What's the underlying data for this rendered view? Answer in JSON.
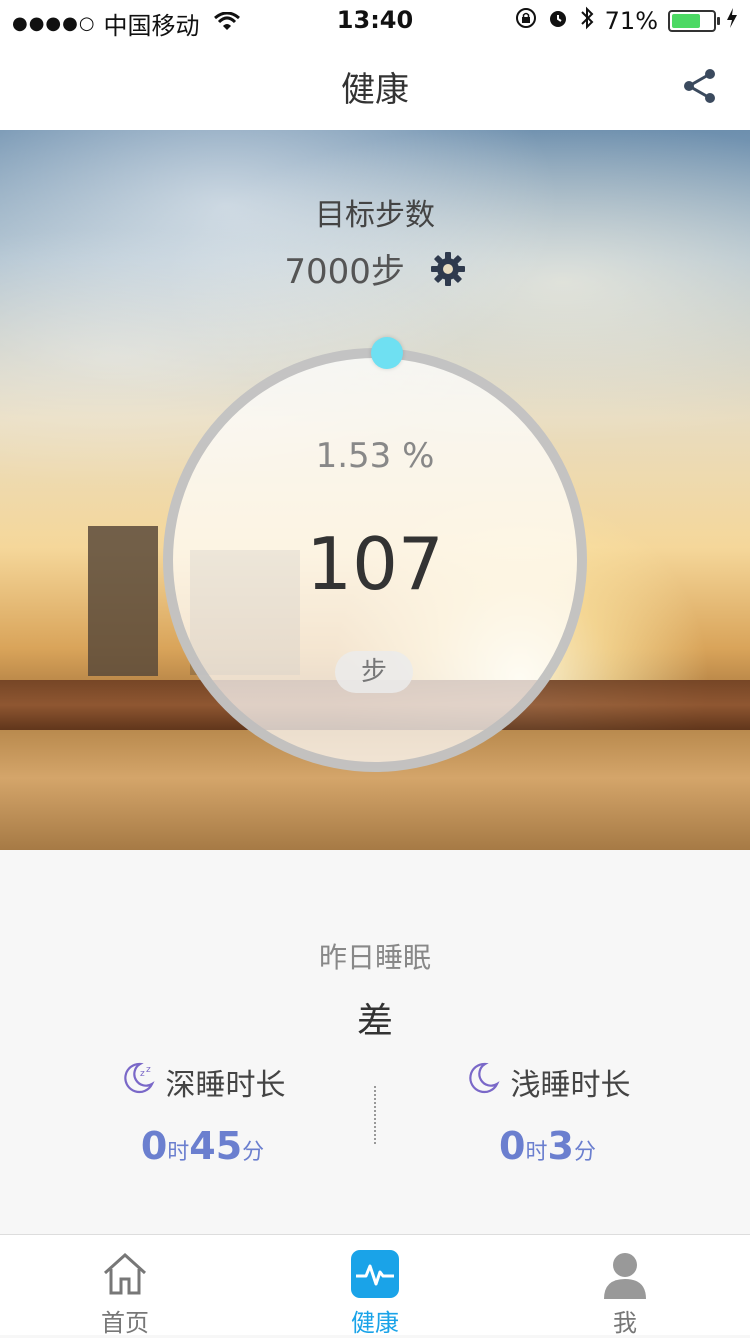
{
  "status_bar": {
    "signal": "●●●●○",
    "carrier": "中国移动",
    "time": "13:40",
    "battery": "71%",
    "battery_level": 0.71
  },
  "header": {
    "title": "健康"
  },
  "goal": {
    "label": "目标步数",
    "value": "7000步"
  },
  "progress": {
    "percent": "1.53 %",
    "steps": "107",
    "unit": "步",
    "fraction": 0.0153
  },
  "sleep": {
    "title": "昨日睡眠",
    "quality": "差",
    "deep": {
      "label": "深睡时长",
      "hours": "0",
      "hours_unit": "时",
      "minutes": "45",
      "minutes_unit": "分"
    },
    "light": {
      "label": "浅睡时长",
      "hours": "0",
      "hours_unit": "时",
      "minutes": "3",
      "minutes_unit": "分"
    }
  },
  "tabs": [
    {
      "label": "首页",
      "icon": "home-icon",
      "active": false
    },
    {
      "label": "健康",
      "icon": "pulse-icon",
      "active": true
    },
    {
      "label": "我",
      "icon": "user-icon",
      "active": false
    }
  ],
  "colors": {
    "accent": "#1aa3e8",
    "sleep_value": "#6b7fcf",
    "knob": "#6fe0f2"
  }
}
